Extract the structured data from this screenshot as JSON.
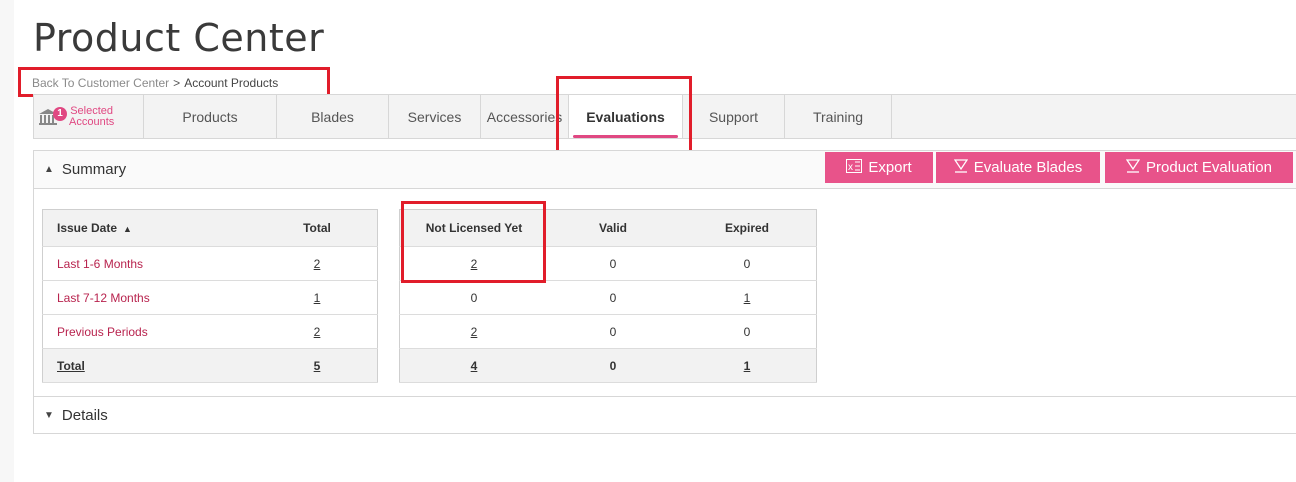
{
  "title": "Product Center",
  "breadcrumb": {
    "link": "Back To Customer Center",
    "separator": ">",
    "current": "Account Products"
  },
  "tabs": {
    "accounts_badge": "1",
    "accounts_label": "Selected\nAccounts",
    "items": [
      "Products",
      "Blades",
      "Services",
      "Accessories",
      "Evaluations",
      "Support",
      "Training"
    ],
    "active": "Evaluations"
  },
  "summary": {
    "label": "Summary",
    "arrow": "▲"
  },
  "details": {
    "label": "Details",
    "arrow": "▼"
  },
  "buttons": {
    "export": "Export",
    "evaluate_blades": "Evaluate Blades",
    "product_evaluation": "Product Evaluation"
  },
  "table_left": {
    "headers": [
      "Issue Date",
      "Total"
    ],
    "sort_icon": "▲",
    "rows": [
      {
        "label": "Last 1-6 Months",
        "total": "2"
      },
      {
        "label": "Last 7-12 Months",
        "total": "1"
      },
      {
        "label": "Previous Periods",
        "total": "2"
      }
    ],
    "total_row": {
      "label": "Total",
      "total": "5"
    }
  },
  "table_right": {
    "headers": [
      "Not Licensed Yet",
      "Valid",
      "Expired"
    ],
    "rows": [
      [
        "2",
        "0",
        "0"
      ],
      [
        "0",
        "0",
        "1"
      ],
      [
        "2",
        "0",
        "0"
      ]
    ],
    "total_row": [
      "4",
      "0",
      "1"
    ]
  },
  "colors": {
    "accent": "#e8538a",
    "highlight_box": "#e11d2a",
    "link_red": "#b8234e"
  }
}
